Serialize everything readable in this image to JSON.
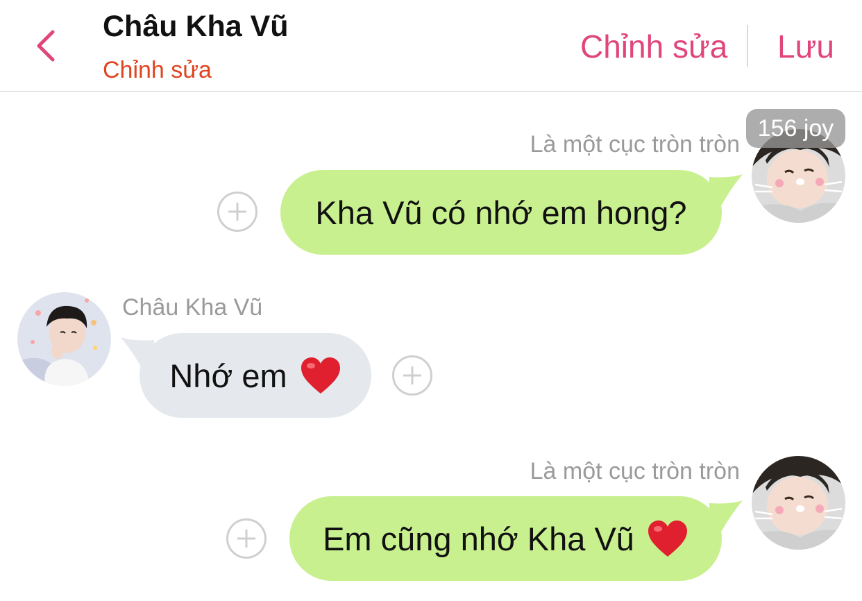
{
  "header": {
    "title": "Châu Kha Vũ",
    "subtitle": "Chỉnh sửa",
    "edit_label": "Chỉnh sửa",
    "save_label": "Lưu"
  },
  "messages": [
    {
      "sender": "Là một cục tròn tròn",
      "text": "Kha Vũ có nhớ em hong?",
      "direction": "outgoing",
      "badge": "156 joy"
    },
    {
      "sender": "Châu Kha Vũ",
      "text": "Nhớ em",
      "emoji": "heart-icon",
      "direction": "incoming"
    },
    {
      "sender": "Là một cục tròn tròn",
      "text": "Em cũng nhớ Kha Vũ",
      "emoji": "heart-icon",
      "direction": "outgoing"
    }
  ],
  "colors": {
    "accent": "#e0457c",
    "subtitle": "#e0441f",
    "outgoing_bubble": "#c9f08f",
    "incoming_bubble": "#e5e8ec",
    "heart": "#e0202e"
  }
}
